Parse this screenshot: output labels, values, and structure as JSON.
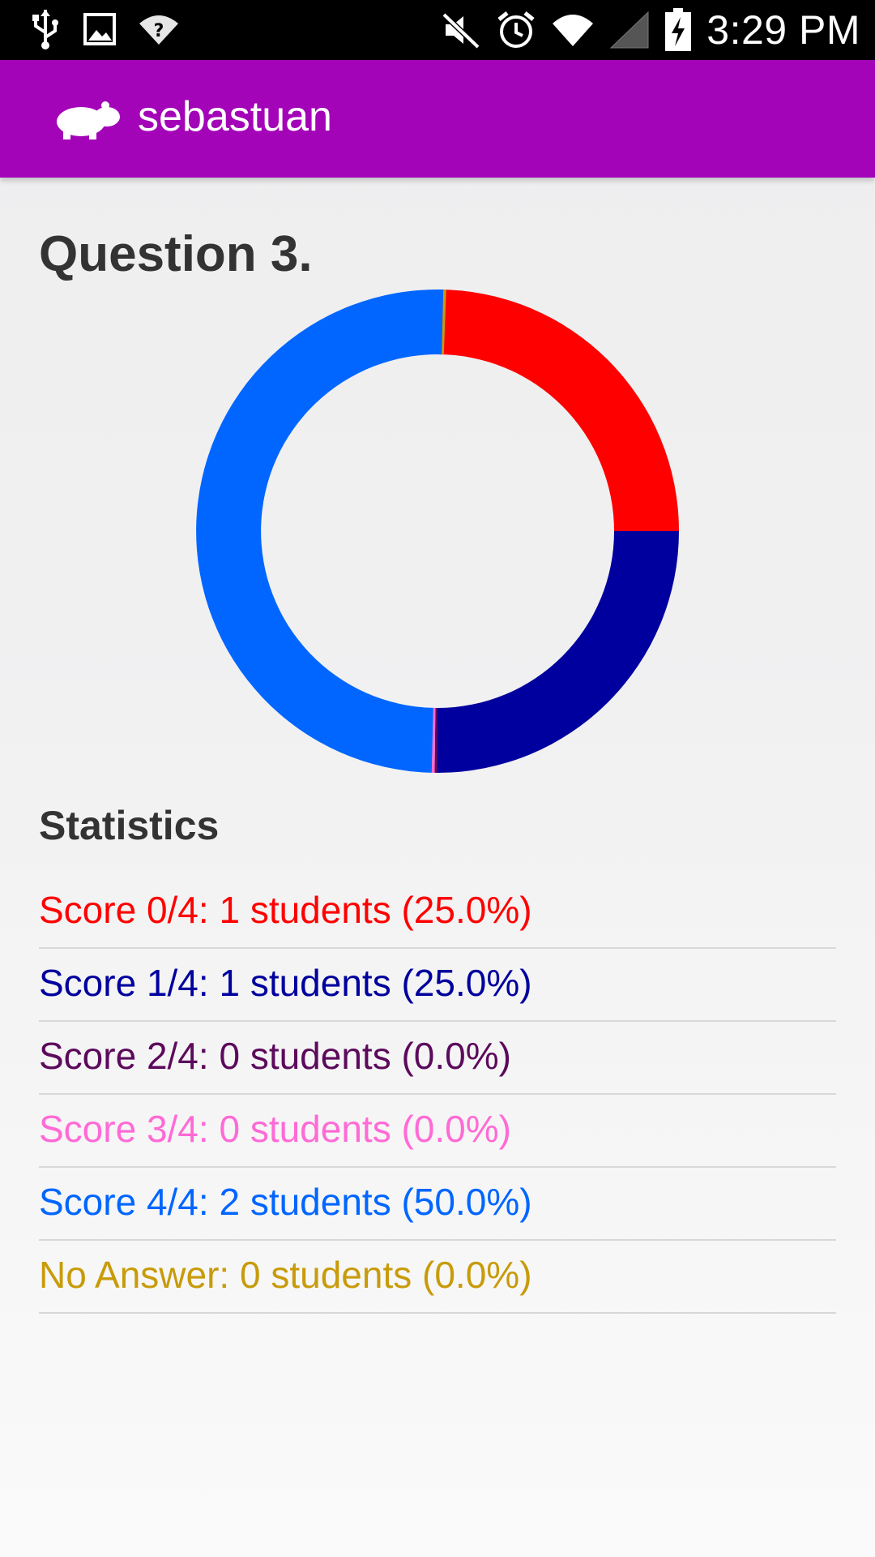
{
  "status_bar": {
    "time": "3:29 PM",
    "left_icons": [
      "usb-icon",
      "image-icon",
      "wifi-question-icon"
    ],
    "right_icons": [
      "mute-icon",
      "alarm-icon",
      "wifi-icon",
      "signal-icon",
      "battery-charging-icon"
    ]
  },
  "app_bar": {
    "title": "sebastuan",
    "logo_icon": "hippo-icon",
    "background": "#a404b8"
  },
  "question": {
    "title": "Question 3."
  },
  "chart_data": {
    "type": "pie",
    "style": "donut",
    "start": "top, clockwise",
    "slices": [
      {
        "label": "Score 0/4",
        "value": 25.0,
        "color": "#ff0000"
      },
      {
        "label": "Score 1/4",
        "value": 25.0,
        "color": "#00009e"
      },
      {
        "label": "Score 2/4",
        "value": 0.0,
        "color": "#5c0a5c"
      },
      {
        "label": "Score 3/4",
        "value": 0.0,
        "color": "#ff6ad5"
      },
      {
        "label": "Score 4/4",
        "value": 50.0,
        "color": "#0066ff"
      },
      {
        "label": "No Answer",
        "value": 0.0,
        "color": "#c89b0a"
      }
    ]
  },
  "statistics": {
    "heading": "Statistics",
    "items": [
      {
        "text": "Score 0/4: 1 students (25.0%)",
        "color": "#ff0000"
      },
      {
        "text": "Score 1/4: 1 students (25.0%)",
        "color": "#00009e"
      },
      {
        "text": "Score 2/4: 0 students (0.0%)",
        "color": "#5c0a5c"
      },
      {
        "text": "Score 3/4: 0 students (0.0%)",
        "color": "#ff6ad5"
      },
      {
        "text": "Score 4/4: 2 students (50.0%)",
        "color": "#0066ff"
      },
      {
        "text": "No Answer: 0 students (0.0%)",
        "color": "#c89b0a"
      }
    ]
  }
}
